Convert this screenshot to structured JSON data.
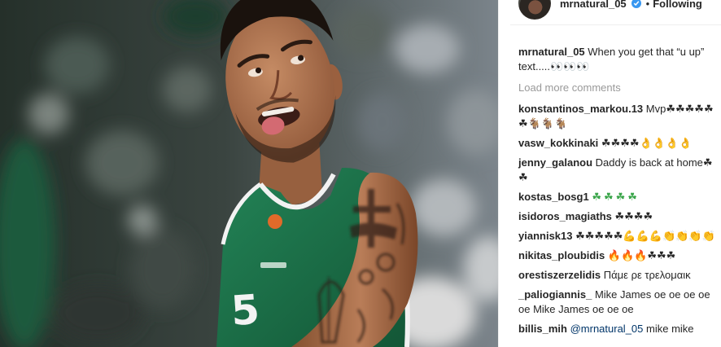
{
  "photo": {
    "jersey_number": "5"
  },
  "header": {
    "username": "mrnatural_05",
    "separator": "•",
    "follow_label": "Following"
  },
  "caption": {
    "username": "mrnatural_05",
    "text": "When you get that “u up” text.....👀👀👀"
  },
  "load_more_label": "Load more comments",
  "comments": [
    {
      "username": "konstantinos_markou.13",
      "text": "Mvp☘☘☘☘☘☘🐐🐐🐐"
    },
    {
      "username": "vasw_kokkinaki",
      "text": "☘☘☘☘👌👌👌👌"
    },
    {
      "username": "jenny_galanou",
      "text": "Daddy is back at home☘☘"
    },
    {
      "username": "kostas_bosg1",
      "text": "☘☘☘☘"
    },
    {
      "username": "isidoros_magiaths",
      "text": "☘☘☘☘"
    },
    {
      "username": "yiannisk13",
      "text": "☘☘☘☘☘💪💪💪👏👏👏👏"
    },
    {
      "username": "nikitas_ploubidis",
      "text": "🔥🔥🔥☘☘☘"
    },
    {
      "username": "orestiszerzelidis",
      "text": "Πάμε ρε τρελομαικ"
    },
    {
      "username": "_paliogiannis_",
      "text": "Mike James oe oe oe oe oe Mike James oe oe oe"
    },
    {
      "username": "billis_mih",
      "mention": "@mrnatural_05",
      "text": "mike mike"
    }
  ],
  "icons": {
    "avatar": "profile-avatar",
    "verified": "verified-badge-icon"
  },
  "colors": {
    "text": "#262626",
    "muted": "#999999",
    "border": "#efefef",
    "verified": "#3897f0",
    "mention": "#003569",
    "jersey_green": "#1d7048",
    "shamrock_green": "#3aa54a"
  }
}
